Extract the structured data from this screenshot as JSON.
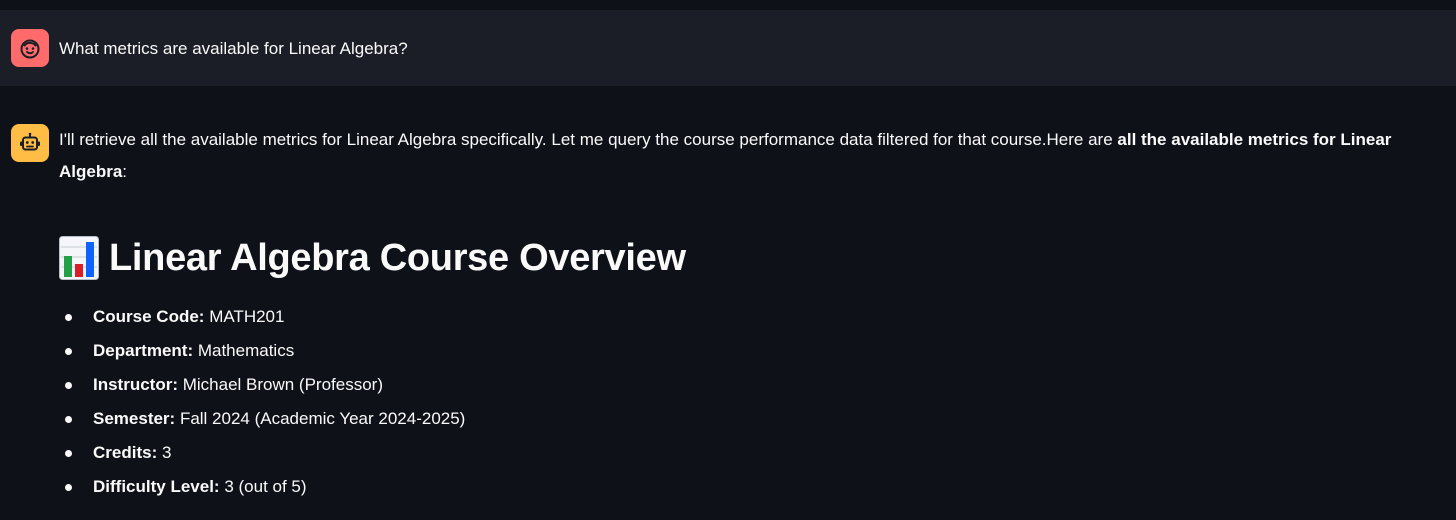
{
  "user_message": {
    "avatar_icon": "smiley-face-icon",
    "avatar_color": "#ff6b6b",
    "text": "What metrics are available for Linear Algebra?"
  },
  "assistant_message": {
    "avatar_icon": "robot-icon",
    "avatar_color": "#ffbd45",
    "intro_text": "I'll retrieve all the available metrics for Linear Algebra specifically. Let me query the course performance data filtered for that course.Here are ",
    "intro_bold": "all the available metrics for Linear Algebra",
    "intro_end": ":",
    "heading_icon": "bar-chart-icon",
    "heading": "Linear Algebra Course Overview",
    "facts": [
      {
        "label": "Course Code:",
        "value": " MATH201"
      },
      {
        "label": "Department:",
        "value": " Mathematics"
      },
      {
        "label": "Instructor:",
        "value": " Michael Brown (Professor)"
      },
      {
        "label": "Semester:",
        "value": " Fall 2024 (Academic Year 2024-2025)"
      },
      {
        "label": "Credits:",
        "value": " 3"
      },
      {
        "label": "Difficulty Level:",
        "value": " 3 (out of 5)"
      }
    ]
  },
  "colors": {
    "background": "#0e1117",
    "user_message_background": "#1b1e26",
    "text": "#fafafa"
  }
}
